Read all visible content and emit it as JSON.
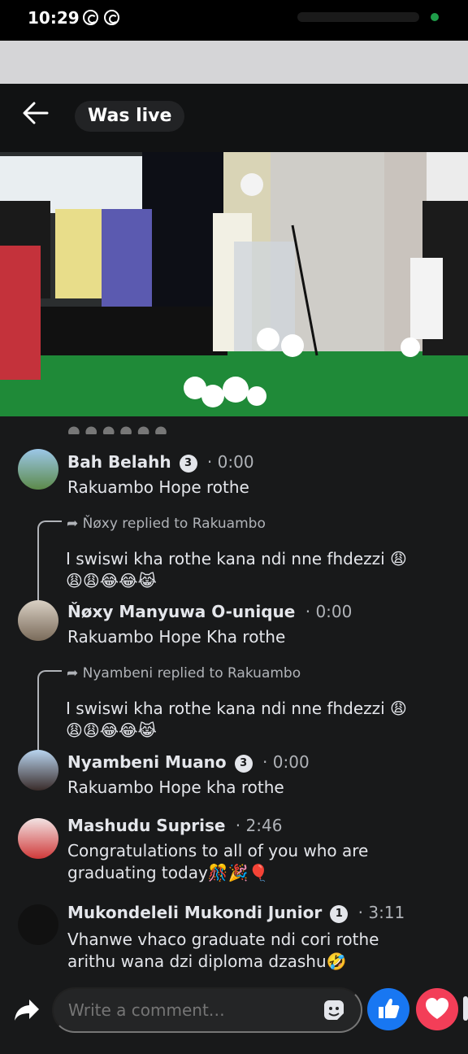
{
  "status_bar": {
    "time": "10:29"
  },
  "header": {
    "live_label": "Was live"
  },
  "comments": [
    {
      "name": "Bah Belahh",
      "badge": "3",
      "time": "0:00",
      "text": "Rakuambo Hope rothe"
    },
    {
      "reply_tag": "Ňøxy replied to Rakuambo",
      "reply_text": "I swiswi kha rothe kana ndi nne fhdezzi 😩😩😩😂😂😹"
    },
    {
      "name": "Ňøxy Manyuwa O-unique",
      "time": "0:00",
      "text": "Rakuambo Hope Kha rothe"
    },
    {
      "reply_tag": "Nyambeni replied to Rakuambo",
      "reply_text": "I swiswi kha rothe kana ndi nne fhdezzi 😩😩😩😂😂😹"
    },
    {
      "name": "Nyambeni Muano",
      "badge": "3",
      "time": "0:00",
      "text": "Rakuambo Hope kha rothe"
    },
    {
      "name": "Mashudu Suprise",
      "time": "2:46",
      "text": "Congratulations to all of you who are graduating today🎊🎉🎈"
    },
    {
      "name": "Mukondeleli Mukondi Junior",
      "badge": "1",
      "time": "3:11",
      "text": "Vhanwe vhaco graduate ndi cori rothe arithu wana dzi diploma dzashu🤣"
    }
  ],
  "composer": {
    "placeholder": "Write a comment…"
  },
  "colors": {
    "like": "#1877f2",
    "love": "#f33e58",
    "background": "#18191a"
  },
  "icons": [
    "back-arrow-icon",
    "share-icon",
    "sticker-icon",
    "like-icon",
    "heart-icon",
    "whatsapp-icon"
  ]
}
